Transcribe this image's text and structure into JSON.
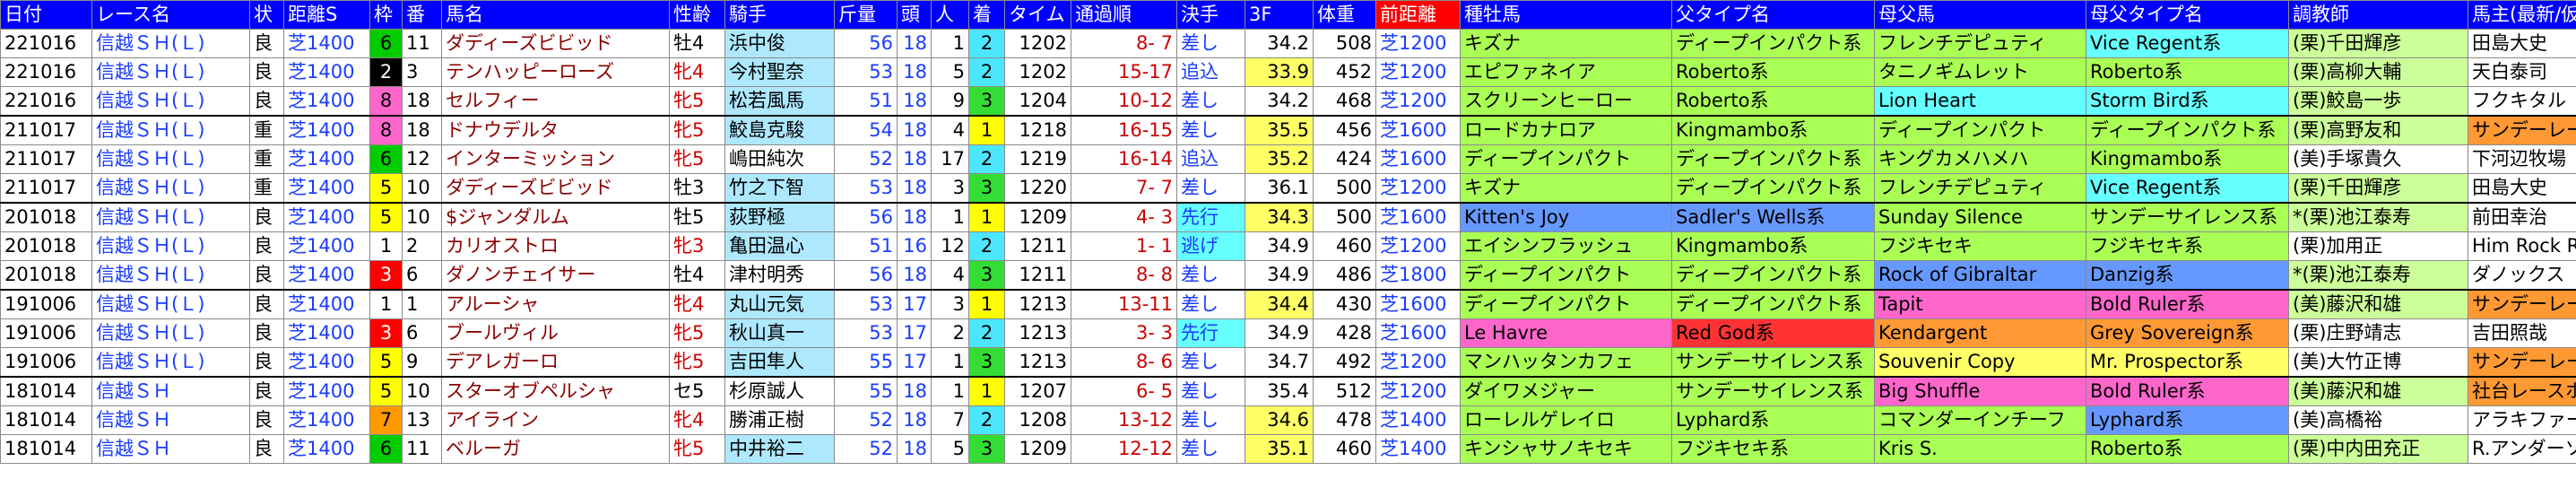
{
  "headers": [
    "日付",
    "レース名",
    "状",
    "距離S",
    "枠",
    "番",
    "馬名",
    "性齢",
    "騎手",
    "斤量",
    "頭",
    "人",
    "着",
    "タイム",
    "通過順",
    "決手",
    "3F",
    "体重",
    "前距離",
    "種牡馬",
    "父タイプ名",
    "母父馬",
    "母父タイプ名",
    "調教師",
    "馬主(最新/仮"
  ],
  "colors": {
    "header_bg": "#0000ff",
    "header_red": "#ff0000",
    "waku": {
      "1": "#ffffff",
      "2": "#000000",
      "3": "#ff0000",
      "4": "#4da3ff",
      "5": "#ffff00",
      "6": "#00cc00",
      "7": "#ff9900",
      "8": "#ff66cc"
    },
    "place1": "#ffff00",
    "place2": "#4de6ff",
    "place3": "#33dd33",
    "jockey_hi": "#aee8ff",
    "fast3f": "#ffff66",
    "pink": "#ff66cc",
    "green": "#33dd33",
    "lime": "#aaff55",
    "blue": "#6699ff",
    "cyan": "#66ffff",
    "orange": "#ff9933",
    "lightgreen": "#ccff99",
    "red": "#ff3333",
    "yellow": "#ffff66"
  },
  "rows": [
    {
      "date": "221016",
      "race": "信越ＳＨ(Ｌ)",
      "cond": "良",
      "dist": "芝1400",
      "waku": "6",
      "num": "11",
      "name": "ダディーズビビッド",
      "sex": "牡4",
      "jockey": "浜中俊",
      "kin": "56",
      "heads": "18",
      "pop": "1",
      "place": "2",
      "time": "1202",
      "pass": "8- 7",
      "style": "差し",
      "f3": "34.2",
      "weight": "508",
      "prev": "芝1200",
      "sire": "キズナ",
      "sire_type": "ディープインパクト系",
      "dam_sire": "フレンチデピュティ",
      "dam_sire_type": "Vice Regent系",
      "trainer": "(栗)千田輝彦",
      "owner": "田島大史"
    },
    {
      "date": "221016",
      "race": "信越ＳＨ(Ｌ)",
      "cond": "良",
      "dist": "芝1400",
      "waku": "2",
      "num": "3",
      "name": "テンハッピーローズ",
      "sex": "牝4",
      "jockey": "今村聖奈",
      "kin": "53",
      "heads": "18",
      "pop": "5",
      "place": "2",
      "time": "1202",
      "pass": "15-17",
      "style": "追込",
      "f3": "33.9",
      "weight": "452",
      "prev": "芝1200",
      "sire": "エピファネイア",
      "sire_type": "Roberto系",
      "dam_sire": "タニノギムレット",
      "dam_sire_type": "Roberto系",
      "trainer": "(栗)高柳大輔",
      "owner": "天白泰司"
    },
    {
      "date": "221016",
      "race": "信越ＳＨ(Ｌ)",
      "cond": "良",
      "dist": "芝1400",
      "waku": "8",
      "num": "18",
      "name": "セルフィー",
      "sex": "牝5",
      "jockey": "松若風馬",
      "kin": "51",
      "heads": "18",
      "pop": "9",
      "place": "3",
      "time": "1204",
      "pass": "10-12",
      "style": "差し",
      "f3": "34.2",
      "weight": "468",
      "prev": "芝1200",
      "sire": "スクリーンヒーロー",
      "sire_type": "Roberto系",
      "dam_sire": "Lion Heart",
      "dam_sire_type": "Storm Bird系",
      "trainer": "(栗)鮫島一歩",
      "owner": "フクキタル"
    },
    {
      "date": "211017",
      "race": "信越ＳＨ(Ｌ)",
      "cond": "重",
      "dist": "芝1400",
      "waku": "8",
      "num": "18",
      "name": "ドナウデルタ",
      "sex": "牝5",
      "jockey": "鮫島克駿",
      "kin": "54",
      "heads": "18",
      "pop": "4",
      "place": "1",
      "time": "1218",
      "pass": "16-15",
      "style": "差し",
      "f3": "35.5",
      "weight": "456",
      "prev": "芝1600",
      "sire": "ロードカナロア",
      "sire_type": "Kingmambo系",
      "dam_sire": "ディープインパクト",
      "dam_sire_type": "ディープインパクト系",
      "trainer": "(栗)高野友和",
      "owner": "サンデーレーシ"
    },
    {
      "date": "211017",
      "race": "信越ＳＨ(Ｌ)",
      "cond": "重",
      "dist": "芝1400",
      "waku": "6",
      "num": "12",
      "name": "インターミッション",
      "sex": "牝5",
      "jockey": "嶋田純次",
      "kin": "52",
      "heads": "18",
      "pop": "17",
      "place": "2",
      "time": "1219",
      "pass": "16-14",
      "style": "追込",
      "f3": "35.2",
      "weight": "424",
      "prev": "芝1600",
      "sire": "ディープインパクト",
      "sire_type": "ディープインパクト系",
      "dam_sire": "キングカメハメハ",
      "dam_sire_type": "Kingmambo系",
      "trainer": "(美)手塚貴久",
      "owner": "下河辺牧場"
    },
    {
      "date": "211017",
      "race": "信越ＳＨ(Ｌ)",
      "cond": "重",
      "dist": "芝1400",
      "waku": "5",
      "num": "10",
      "name": "ダディーズビビッド",
      "sex": "牡3",
      "jockey": "竹之下智",
      "kin": "53",
      "heads": "18",
      "pop": "3",
      "place": "3",
      "time": "1220",
      "pass": "7- 7",
      "style": "差し",
      "f3": "36.1",
      "weight": "500",
      "prev": "芝1200",
      "sire": "キズナ",
      "sire_type": "ディープインパクト系",
      "dam_sire": "フレンチデピュティ",
      "dam_sire_type": "Vice Regent系",
      "trainer": "(栗)千田輝彦",
      "owner": "田島大史"
    },
    {
      "date": "201018",
      "race": "信越ＳＨ(Ｌ)",
      "cond": "良",
      "dist": "芝1400",
      "waku": "5",
      "num": "10",
      "name": "$ジャンダルム",
      "sex": "牡5",
      "jockey": "荻野極",
      "kin": "56",
      "heads": "18",
      "pop": "1",
      "place": "1",
      "time": "1209",
      "pass": "4- 3",
      "style": "先行",
      "f3": "34.3",
      "weight": "500",
      "prev": "芝1600",
      "sire": "Kitten's Joy",
      "sire_type": "Sadler's Wells系",
      "dam_sire": "Sunday Silence",
      "dam_sire_type": "サンデーサイレンス系",
      "trainer": "*(栗)池江泰寿",
      "owner": "前田幸治"
    },
    {
      "date": "201018",
      "race": "信越ＳＨ(Ｌ)",
      "cond": "良",
      "dist": "芝1400",
      "waku": "1",
      "num": "2",
      "name": "カリオストロ",
      "sex": "牝3",
      "jockey": "亀田温心",
      "kin": "51",
      "heads": "16",
      "pop": "12",
      "place": "2",
      "time": "1211",
      "pass": "1- 1",
      "style": "逃げ",
      "f3": "34.9",
      "weight": "460",
      "prev": "芝1200",
      "sire": "エイシンフラッシュ",
      "sire_type": "Kingmambo系",
      "dam_sire": "フジキセキ",
      "dam_sire_type": "フジキセキ系",
      "trainer": "(栗)加用正",
      "owner": "Him Rock Rac"
    },
    {
      "date": "201018",
      "race": "信越ＳＨ(Ｌ)",
      "cond": "良",
      "dist": "芝1400",
      "waku": "3",
      "num": "6",
      "name": "ダノンチェイサー",
      "sex": "牡4",
      "jockey": "津村明秀",
      "kin": "56",
      "heads": "18",
      "pop": "4",
      "place": "3",
      "time": "1211",
      "pass": "8- 8",
      "style": "差し",
      "f3": "34.9",
      "weight": "486",
      "prev": "芝1800",
      "sire": "ディープインパクト",
      "sire_type": "ディープインパクト系",
      "dam_sire": "Rock of Gibraltar",
      "dam_sire_type": "Danzig系",
      "trainer": "*(栗)池江泰寿",
      "owner": "ダノックス"
    },
    {
      "date": "191006",
      "race": "信越ＳＨ(Ｌ)",
      "cond": "良",
      "dist": "芝1400",
      "waku": "1",
      "num": "1",
      "name": "アルーシャ",
      "sex": "牝4",
      "jockey": "丸山元気",
      "kin": "53",
      "heads": "17",
      "pop": "3",
      "place": "1",
      "time": "1213",
      "pass": "13-11",
      "style": "差し",
      "f3": "34.4",
      "weight": "430",
      "prev": "芝1600",
      "sire": "ディープインパクト",
      "sire_type": "ディープインパクト系",
      "dam_sire": "Tapit",
      "dam_sire_type": "Bold Ruler系",
      "trainer": "(美)藤沢和雄",
      "owner": "サンデーレーシ"
    },
    {
      "date": "191006",
      "race": "信越ＳＨ(Ｌ)",
      "cond": "良",
      "dist": "芝1400",
      "waku": "3",
      "num": "6",
      "name": "ブールヴィル",
      "sex": "牝5",
      "jockey": "秋山真一",
      "kin": "53",
      "heads": "17",
      "pop": "2",
      "place": "2",
      "time": "1213",
      "pass": "3- 3",
      "style": "先行",
      "f3": "34.9",
      "weight": "428",
      "prev": "芝1600",
      "sire": "Le Havre",
      "sire_type": "Red God系",
      "dam_sire": "Kendargent",
      "dam_sire_type": "Grey Sovereign系",
      "trainer": "(栗)庄野靖志",
      "owner": "吉田照哉"
    },
    {
      "date": "191006",
      "race": "信越ＳＨ(Ｌ)",
      "cond": "良",
      "dist": "芝1400",
      "waku": "5",
      "num": "9",
      "name": "デアレガーロ",
      "sex": "牝5",
      "jockey": "吉田隼人",
      "kin": "55",
      "heads": "17",
      "pop": "1",
      "place": "3",
      "time": "1213",
      "pass": "8- 6",
      "style": "差し",
      "f3": "34.7",
      "weight": "492",
      "prev": "芝1200",
      "sire": "マンハッタンカフェ",
      "sire_type": "サンデーサイレンス系",
      "dam_sire": "Souvenir Copy",
      "dam_sire_type": "Mr. Prospector系",
      "trainer": "(美)大竹正博",
      "owner": "サンデーレーシ"
    },
    {
      "date": "181014",
      "race": "信越ＳＨ",
      "cond": "良",
      "dist": "芝1400",
      "waku": "5",
      "num": "10",
      "name": "スターオブペルシャ",
      "sex": "セ5",
      "jockey": "杉原誠人",
      "kin": "55",
      "heads": "18",
      "pop": "1",
      "place": "1",
      "time": "1207",
      "pass": "6- 5",
      "style": "差し",
      "f3": "35.4",
      "weight": "512",
      "prev": "芝1200",
      "sire": "ダイワメジャー",
      "sire_type": "サンデーサイレンス系",
      "dam_sire": "Big Shuffle",
      "dam_sire_type": "Bold Ruler系",
      "trainer": "(美)藤沢和雄",
      "owner": "社台レースホー"
    },
    {
      "date": "181014",
      "race": "信越ＳＨ",
      "cond": "良",
      "dist": "芝1400",
      "waku": "7",
      "num": "13",
      "name": "アイライン",
      "sex": "牝4",
      "jockey": "勝浦正樹",
      "kin": "52",
      "heads": "18",
      "pop": "7",
      "place": "2",
      "time": "1208",
      "pass": "13-12",
      "style": "差し",
      "f3": "34.6",
      "weight": "478",
      "prev": "芝1400",
      "sire": "ローレルゲレイロ",
      "sire_type": "Lyphard系",
      "dam_sire": "コマンダーインチーフ",
      "dam_sire_type": "Lyphard系",
      "trainer": "(美)高橋裕",
      "owner": "アラキファーム"
    },
    {
      "date": "181014",
      "race": "信越ＳＨ",
      "cond": "良",
      "dist": "芝1400",
      "waku": "6",
      "num": "11",
      "name": "ベルーガ",
      "sex": "牝5",
      "jockey": "中井裕二",
      "kin": "52",
      "heads": "18",
      "pop": "5",
      "place": "3",
      "time": "1209",
      "pass": "12-12",
      "style": "差し",
      "f3": "35.1",
      "weight": "460",
      "prev": "芝1400",
      "sire": "キンシャサノキセキ",
      "sire_type": "フジキセキ系",
      "dam_sire": "Kris S.",
      "dam_sire_type": "Roberto系",
      "trainer": "(栗)中内田充正",
      "owner": "R.アンダーソン"
    }
  ]
}
